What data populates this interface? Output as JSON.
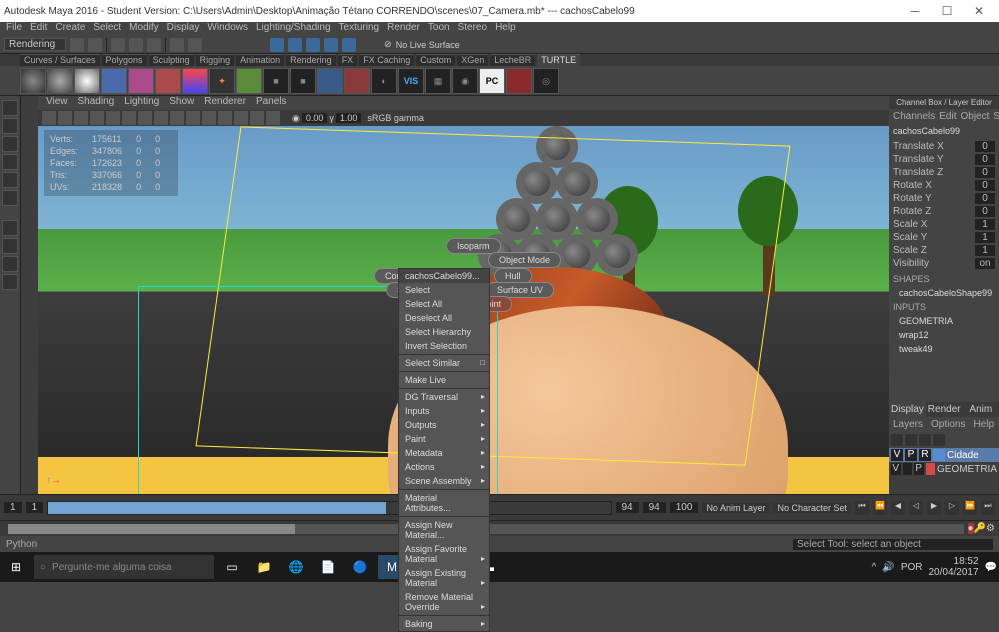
{
  "title": "Autodesk Maya 2016 - Student Version: C:\\Users\\Admin\\Desktop\\Animação Tétano CORRENDO\\scenes\\07_Camera.mb*   ---   cachosCabelo99",
  "menubar": [
    "File",
    "Edit",
    "Create",
    "Select",
    "Modify",
    "Display",
    "Windows",
    "Lighting/Shading",
    "Texturing",
    "Render",
    "Toon",
    "Stereo",
    "Help"
  ],
  "toolbar": {
    "workspace": "Rendering",
    "nolive": "No Live Surface"
  },
  "shelf_tabs": [
    "Curves / Surfaces",
    "Polygons",
    "Sculpting",
    "Rigging",
    "Animation",
    "Rendering",
    "FX",
    "FX Caching",
    "Custom",
    "XGen",
    "LecheBR",
    "TURTLE"
  ],
  "vp_menu": [
    "View",
    "Shading",
    "Lighting",
    "Show",
    "Renderer",
    "Panels"
  ],
  "vp_tools": {
    "val1": "0.00",
    "val2": "1.00",
    "gamma": "sRGB gamma"
  },
  "hud": {
    "rows": [
      [
        "Verts:",
        "175611",
        "0",
        "0"
      ],
      [
        "Edges:",
        "347806",
        "0",
        "0"
      ],
      [
        "Faces:",
        "172623",
        "0",
        "0"
      ],
      [
        "Tris:",
        "337066",
        "0",
        "0"
      ],
      [
        "UVs:",
        "218328",
        "0",
        "0"
      ]
    ]
  },
  "marking": {
    "isoparm": "Isoparm",
    "objmode": "Object Mode",
    "ctrlvert": "Control Vertex",
    "hull": "Hull",
    "surfpatch": "Surface Patch",
    "surfuv": "Surface UV",
    "surfpoint": "Surface Point"
  },
  "ctx": {
    "header": "cachosCabelo99...",
    "items1": [
      "Select",
      "Select All",
      "Deselect All",
      "Select Hierarchy",
      "Invert Selection"
    ],
    "similar": "Select Similar",
    "live": "Make Live",
    "items2": [
      "DG Traversal",
      "Inputs",
      "Outputs",
      "Paint",
      "Metadata",
      "Actions",
      "Scene Assembly"
    ],
    "matattr": "Material Attributes...",
    "items3": [
      "Assign New Material...",
      "Assign Favorite Material",
      "Assign Existing Material",
      "Remove Material Override"
    ],
    "baking": "Baking"
  },
  "channel": {
    "title": "Channel Box / Layer Editor",
    "tabs": [
      "Channels",
      "Edit",
      "Object",
      "Show"
    ],
    "node": "cachosCabelo99",
    "attrs": [
      [
        "Translate X",
        "0"
      ],
      [
        "Translate Y",
        "0"
      ],
      [
        "Translate Z",
        "0"
      ],
      [
        "Rotate X",
        "0"
      ],
      [
        "Rotate Y",
        "0"
      ],
      [
        "Rotate Z",
        "0"
      ],
      [
        "Scale X",
        "1"
      ],
      [
        "Scale Y",
        "1"
      ],
      [
        "Scale Z",
        "1"
      ],
      [
        "Visibility",
        "on"
      ]
    ],
    "shapes": "SHAPES",
    "shape": "cachosCabeloShape99",
    "inputs": "INPUTS",
    "in1": "GEOMETRIA",
    "in2": "wrap12",
    "in3": "tweak49",
    "disp_tabs": [
      "Display",
      "Render",
      "Anim"
    ],
    "layer_menu": [
      "Layers",
      "Options",
      "Help"
    ],
    "layers": [
      {
        "v": "V",
        "p": "P",
        "r": "R",
        "color": "#5a8ad4",
        "name": "Cidade",
        "sel": true
      },
      {
        "v": "V",
        "p": "",
        "r": "P",
        "color": "#d44a4a",
        "name": "GEOMETRIA",
        "sel": false
      }
    ]
  },
  "timeline": {
    "start": "1",
    "f1": "1",
    "cur": "94",
    "f2": "94",
    "end": "100",
    "animlayer": "No Anim Layer",
    "charset": "No Character Set"
  },
  "status": {
    "lang": "Python",
    "hint": "Select Tool: select an object"
  },
  "taskbar": {
    "search_ph": "Pergunte-me alguma coisa",
    "lang": "POR",
    "date": "20/04/2017",
    "time": "18:52"
  }
}
